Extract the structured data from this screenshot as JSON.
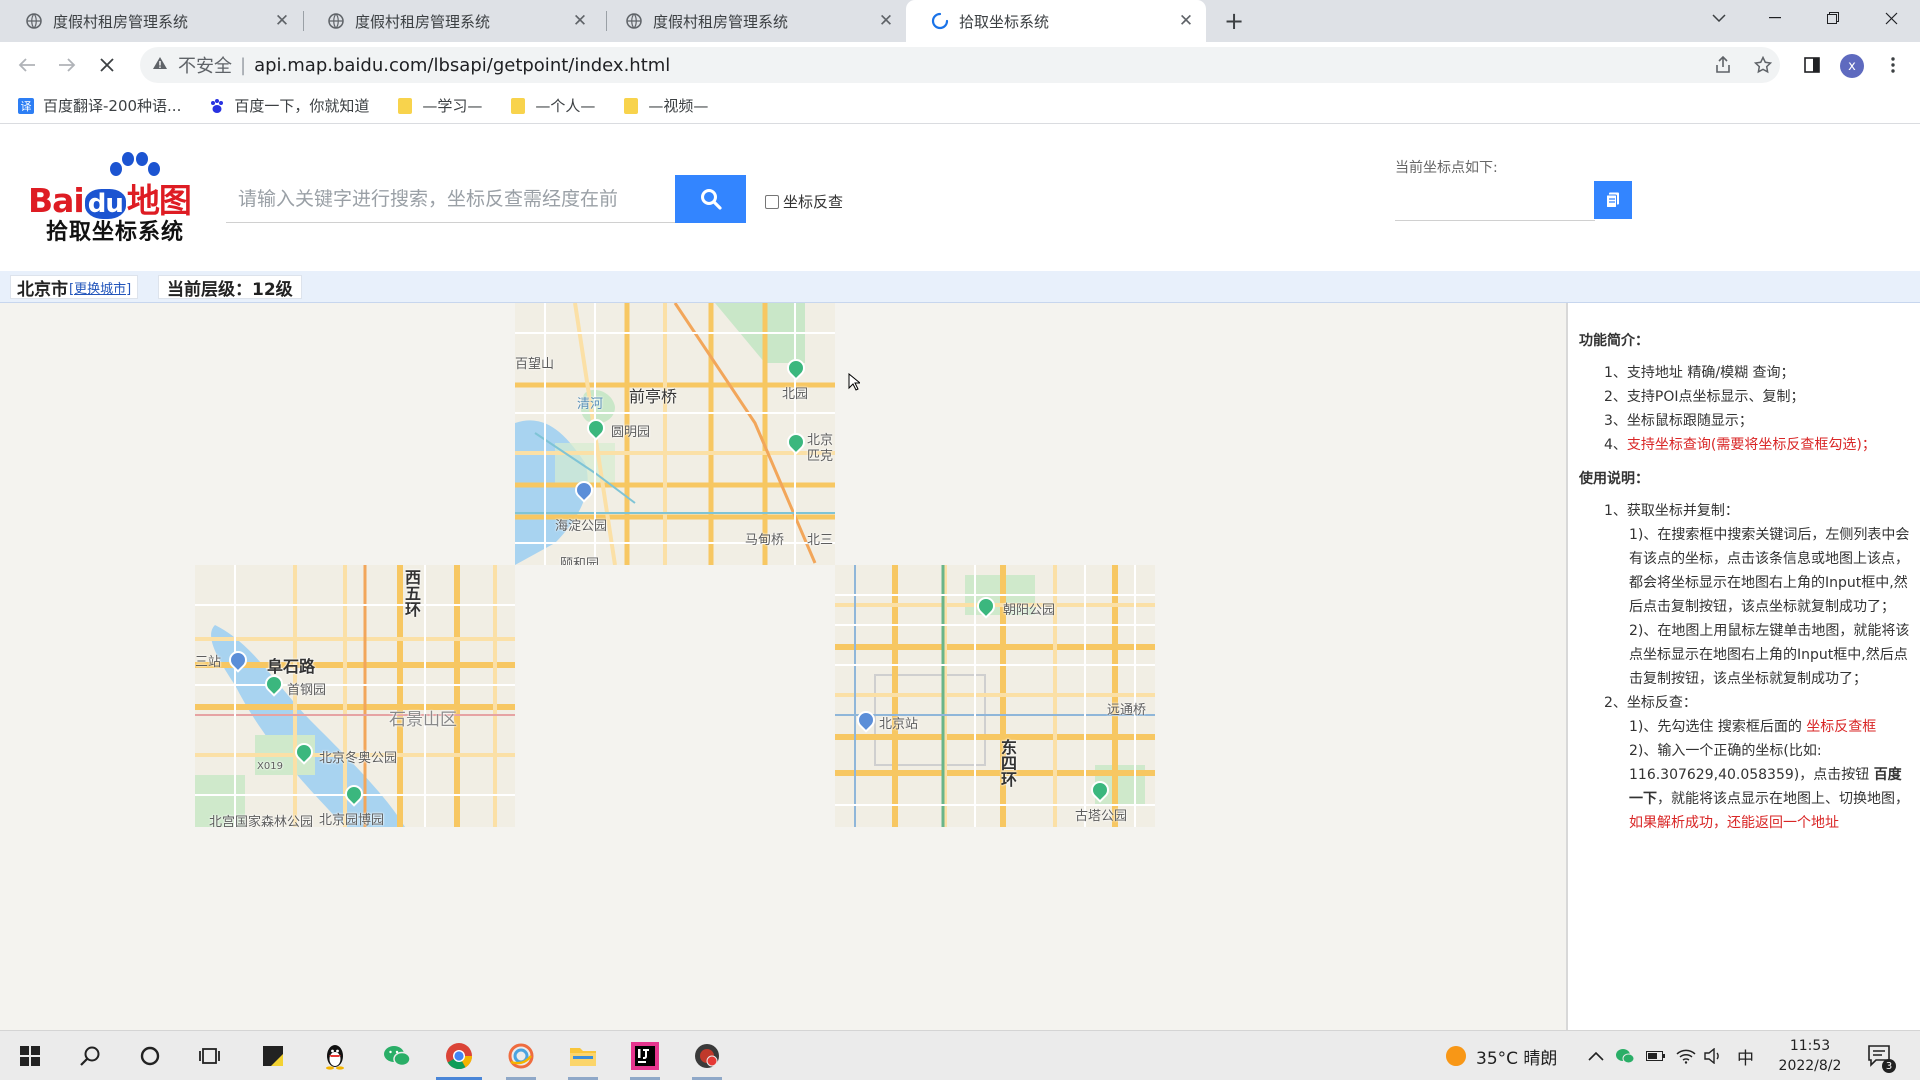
{
  "browser": {
    "tabs": [
      {
        "title": "度假村租房管理系统"
      },
      {
        "title": "度假村租房管理系统"
      },
      {
        "title": "度假村租房管理系统"
      },
      {
        "title": "拾取坐标系统"
      }
    ],
    "address": {
      "insecure_label": "不安全",
      "url": "api.map.baidu.com/lbsapi/getpoint/index.html"
    },
    "profile_initial": "x",
    "bookmarks": [
      {
        "label": "百度翻译-200种语..."
      },
      {
        "label": "百度一下，你就知道"
      },
      {
        "label": "—学习—"
      },
      {
        "label": "—个人—"
      },
      {
        "label": "—视频—"
      }
    ]
  },
  "header": {
    "logo_text_left": "Bai",
    "logo_text_du": "du",
    "logo_text_right": "地图",
    "logo_subtitle": "拾取坐标系统",
    "search_placeholder": "请输入关键字进行搜索，坐标反查需经度在前",
    "reverse_lookup_label": "坐标反查",
    "coord_label": "当前坐标点如下:",
    "coord_value": ""
  },
  "info_bar": {
    "city": "北京市",
    "change_city": "[更换城市]",
    "level": "当前层级：12级"
  },
  "map": {
    "tile_top_labels": [
      "百望山",
      "清河",
      "圆明园",
      "前亭桥",
      "北园",
      "北京",
      "匹克",
      "海淀公园",
      "马甸桥",
      "北三",
      "颐和园"
    ],
    "tile_left_labels": [
      "西五环",
      "阜石路",
      "三站",
      "首钢园",
      "石景山区",
      "北京冬奥公园",
      "北京园博园",
      "北宫国家森林公园",
      "X019"
    ],
    "tile_right_labels": [
      "朝阳公园",
      "北京站",
      "远通桥",
      "东四环",
      "古塔公园"
    ]
  },
  "side_panel": {
    "intro_title": "功能简介：",
    "intro_items": [
      "1、支持地址 精确/模糊 查询；",
      "2、支持POI点坐标显示、复制；",
      "3、坐标鼠标跟随显示；",
      "4、"
    ],
    "intro_item4_red": "支持坐标查询(需要将坐标反查框勾选)；",
    "usage_title": "使用说明：",
    "usage_1": "1、获取坐标并复制：",
    "usage_1_1": "1)、在搜索框中搜索关键词后，左侧列表中会有该点的坐标，点击该条信息或地图上该点，都会将坐标显示在地图右上角的Input框中,然后点击复制按钮，该点坐标就复制成功了；",
    "usage_1_2": "2)、在地图上用鼠标左键单击地图，就能将该点坐标显示在地图右上角的Input框中,然后点击复制按钮，该点坐标就复制成功了；",
    "usage_2": "2、坐标反查：",
    "usage_2_1_prefix": "1)、先勾选住 搜索框后面的 ",
    "usage_2_1_red": "坐标反查框",
    "usage_2_2_prefix": "2)、输入一个正确的坐标(比如: 116.307629,40.058359)，点击按钮 ",
    "usage_2_2_bold": "百度一下",
    "usage_2_2_mid": "，就能将该点显示在地图上、切换地图，",
    "usage_2_2_red": "如果解析成功，还能返回一个地址"
  },
  "taskbar": {
    "weather": "35°C 晴朗",
    "ime": "中",
    "time": "11:53",
    "date": "2022/8/2",
    "notification_count": "3"
  },
  "colors": {
    "baidu_red": "#de1c23",
    "baidu_blue": "#3385ff",
    "note_red": "#d92626"
  }
}
